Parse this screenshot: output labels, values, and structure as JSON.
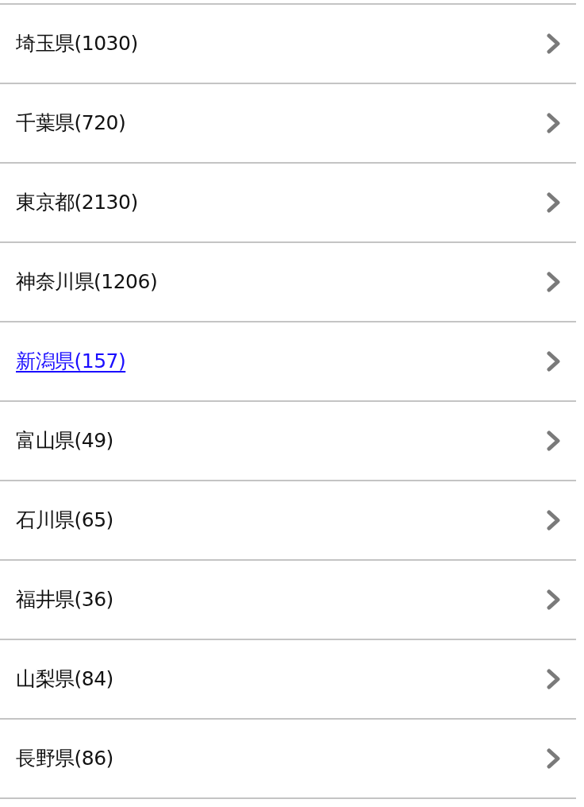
{
  "items": [
    {
      "label": "埼玉県(1030)",
      "focused": false
    },
    {
      "label": "千葉県(720)",
      "focused": false
    },
    {
      "label": "東京都(2130)",
      "focused": false
    },
    {
      "label": "神奈川県(1206)",
      "focused": false
    },
    {
      "label": "新潟県(157)",
      "focused": true
    },
    {
      "label": "富山県(49)",
      "focused": false
    },
    {
      "label": "石川県(65)",
      "focused": false
    },
    {
      "label": "福井県(36)",
      "focused": false
    },
    {
      "label": "山梨県(84)",
      "focused": false
    },
    {
      "label": "長野県(86)",
      "focused": false
    }
  ]
}
